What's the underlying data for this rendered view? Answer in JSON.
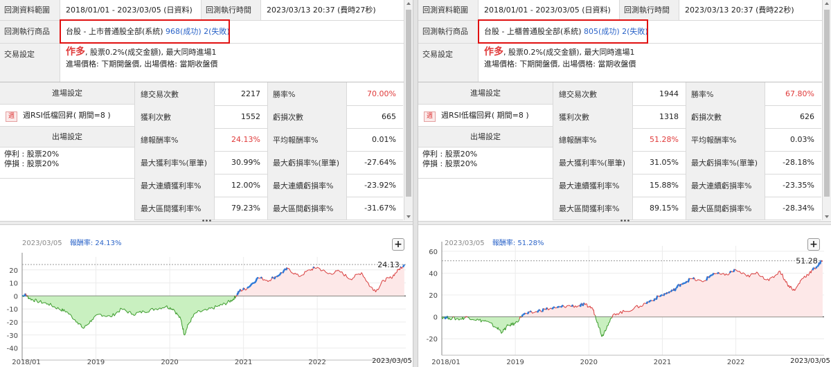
{
  "panels": [
    {
      "backtest_range_label": "回測資料範圍",
      "backtest_range_value": "2018/01/01 - 2023/03/05 (日資料)",
      "exec_time_label": "回測執行時間",
      "exec_time_value": "2023/03/13 20:37 (費時27秒)",
      "product_label": "回測執行商品",
      "product_name": "台股 - 上市普通股全部(系統)",
      "product_success": "968(成功)",
      "product_fail": "2(失敗)",
      "trade_label": "交易設定",
      "trade_direction": "作多",
      "trade_line1": ", 股票0.2%(成交金額), 最大同時進場1",
      "trade_line2": "進場價格: 下期開盤價, 出場價格: 當期收盤價",
      "entry_header": "進場設定",
      "entry_tag": "週",
      "entry_value": "週RSI低檔回昇( 期間=8 )",
      "exit_header": "出場設定",
      "exit_line1": "停利 : 股票20%",
      "exit_line2": "停損 : 股票20%",
      "stats": [
        {
          "l1": "總交易次數",
          "v1": "2217",
          "l2": "勝率%",
          "v2": "70.00%",
          "v2red": true
        },
        {
          "l1": "獲利次數",
          "v1": "1552",
          "l2": "虧損次數",
          "v2": "665"
        },
        {
          "l1": "總報酬率%",
          "v1": "24.13%",
          "v1red": true,
          "l2": "平均報酬率%",
          "v2": "0.01%"
        },
        {
          "l1": "最大獲利率%(單筆)",
          "v1": "30.99%",
          "l2": "最大虧損率%(單筆)",
          "v2": "-27.64%"
        },
        {
          "l1": "最大連續獲利率%",
          "v1": "12.00%",
          "l2": "最大連續虧損率%",
          "v2": "-23.92%"
        },
        {
          "l1": "最大區間獲利率%",
          "v1": "79.23%",
          "l2": "最大區間虧損率%",
          "v2": "-31.67%"
        }
      ],
      "chart_header_date": "2023/03/05",
      "chart_header_label": "報酬率: 24.13%",
      "chart_last_label": "24.13",
      "chart_bottom_date": "2023/03/05",
      "add_glyph": "+",
      "divider_glyph": "•••",
      "chart_data": {
        "type": "area",
        "series_name": "報酬率",
        "yticks": [
          -40,
          -30,
          -20,
          -10,
          0,
          10,
          20
        ],
        "ytick_labels": [
          "-40",
          "-30",
          "-20",
          "-10",
          "0",
          "10",
          "20"
        ],
        "ylim": [
          -45,
          30
        ],
        "xlim": [
          2018.0,
          2023.2
        ],
        "xticks": [
          2018.0,
          2019.0,
          2020.0,
          2021.0,
          2022.0
        ],
        "xtick_labels": [
          "2018/01",
          "2019",
          "2020",
          "2021",
          "2022"
        ],
        "keypoints": [
          [
            2018.0,
            0
          ],
          [
            2018.05,
            1
          ],
          [
            2018.1,
            -2
          ],
          [
            2018.2,
            -4
          ],
          [
            2018.35,
            -6
          ],
          [
            2018.5,
            -10
          ],
          [
            2018.6,
            -12
          ],
          [
            2018.75,
            -20
          ],
          [
            2018.83,
            -25
          ],
          [
            2018.95,
            -18
          ],
          [
            2019.05,
            -14
          ],
          [
            2019.2,
            -16
          ],
          [
            2019.35,
            -10
          ],
          [
            2019.5,
            -14
          ],
          [
            2019.65,
            -12
          ],
          [
            2019.8,
            -10
          ],
          [
            2019.95,
            -8
          ],
          [
            2020.05,
            -10
          ],
          [
            2020.15,
            -18
          ],
          [
            2020.2,
            -30
          ],
          [
            2020.25,
            -22
          ],
          [
            2020.35,
            -13
          ],
          [
            2020.5,
            -11
          ],
          [
            2020.65,
            -8
          ],
          [
            2020.75,
            -6
          ],
          [
            2020.85,
            -3
          ],
          [
            2020.9,
            0
          ],
          [
            2020.95,
            4
          ],
          [
            2021.05,
            6
          ],
          [
            2021.2,
            14
          ],
          [
            2021.35,
            12
          ],
          [
            2021.5,
            17
          ],
          [
            2021.6,
            21
          ],
          [
            2021.75,
            15
          ],
          [
            2021.9,
            20
          ],
          [
            2022.0,
            22
          ],
          [
            2022.15,
            17
          ],
          [
            2022.3,
            19
          ],
          [
            2022.45,
            13
          ],
          [
            2022.6,
            18
          ],
          [
            2022.72,
            7
          ],
          [
            2022.8,
            4
          ],
          [
            2022.9,
            12
          ],
          [
            2023.0,
            14
          ],
          [
            2023.1,
            20
          ],
          [
            2023.18,
            24.13
          ]
        ],
        "dashed_ref": 24.13
      }
    },
    {
      "backtest_range_label": "回測資料範圍",
      "backtest_range_value": "2018/01/01 - 2023/03/05 (日資料)",
      "exec_time_label": "回測執行時間",
      "exec_time_value": "2023/03/13 20:37 (費時22秒)",
      "product_label": "回測執行商品",
      "product_name": "台股 - 上櫃普通股全部(系統)",
      "product_success": "805(成功)",
      "product_fail": "2(失敗)",
      "trade_label": "交易設定",
      "trade_direction": "作多",
      "trade_line1": ", 股票0.2%(成交金額), 最大同時進場1",
      "trade_line2": "進場價格: 下期開盤價, 出場價格: 當期收盤價",
      "entry_header": "進場設定",
      "entry_tag": "週",
      "entry_value": "週RSI低檔回昇( 期間=8 )",
      "exit_header": "出場設定",
      "exit_line1": "停利 : 股票20%",
      "exit_line2": "停損 : 股票20%",
      "stats": [
        {
          "l1": "總交易次數",
          "v1": "1944",
          "l2": "勝率%",
          "v2": "67.80%",
          "v2red": true
        },
        {
          "l1": "獲利次數",
          "v1": "1318",
          "l2": "虧損次數",
          "v2": "626"
        },
        {
          "l1": "總報酬率%",
          "v1": "51.28%",
          "v1red": true,
          "l2": "平均報酬率%",
          "v2": "0.03%"
        },
        {
          "l1": "最大獲利率%(單筆)",
          "v1": "31.05%",
          "l2": "最大虧損率%(單筆)",
          "v2": "-28.18%"
        },
        {
          "l1": "最大連續獲利率%",
          "v1": "15.88%",
          "l2": "最大連續虧損率%",
          "v2": "-23.35%"
        },
        {
          "l1": "最大區間獲利率%",
          "v1": "89.15%",
          "l2": "最大區間虧損率%",
          "v2": "-28.34%"
        }
      ],
      "chart_header_date": "2023/03/05",
      "chart_header_label": "報酬率: 51.28%",
      "chart_last_label": "51.28",
      "chart_bottom_date": "2023/03/05",
      "add_glyph": "+",
      "divider_glyph": "•••",
      "chart_data": {
        "type": "area",
        "series_name": "報酬率",
        "yticks": [
          -20,
          0,
          20,
          40,
          60
        ],
        "ytick_labels": [
          "-20",
          "0",
          "20",
          "40",
          "60"
        ],
        "ylim": [
          -30,
          65
        ],
        "xlim": [
          2018.0,
          2023.2
        ],
        "xticks": [
          2018.0,
          2019.0,
          2020.0,
          2021.0,
          2022.0
        ],
        "xtick_labels": [
          "2018/01",
          "2019",
          "2020",
          "2021",
          "2022"
        ],
        "keypoints": [
          [
            2018.0,
            0
          ],
          [
            2018.1,
            -1
          ],
          [
            2018.25,
            -2
          ],
          [
            2018.35,
            0
          ],
          [
            2018.5,
            -3
          ],
          [
            2018.6,
            -4
          ],
          [
            2018.75,
            -10
          ],
          [
            2018.82,
            -14
          ],
          [
            2018.9,
            -8
          ],
          [
            2019.0,
            -6
          ],
          [
            2019.1,
            2
          ],
          [
            2019.25,
            4
          ],
          [
            2019.4,
            7
          ],
          [
            2019.55,
            8
          ],
          [
            2019.7,
            10
          ],
          [
            2019.85,
            10
          ],
          [
            2019.95,
            11
          ],
          [
            2020.05,
            8
          ],
          [
            2020.12,
            -5
          ],
          [
            2020.18,
            -18
          ],
          [
            2020.25,
            -8
          ],
          [
            2020.35,
            3
          ],
          [
            2020.5,
            5
          ],
          [
            2020.7,
            10
          ],
          [
            2020.85,
            15
          ],
          [
            2021.0,
            20
          ],
          [
            2021.15,
            24
          ],
          [
            2021.25,
            30
          ],
          [
            2021.4,
            35
          ],
          [
            2021.55,
            32
          ],
          [
            2021.7,
            40
          ],
          [
            2021.85,
            38
          ],
          [
            2022.0,
            43
          ],
          [
            2022.15,
            37
          ],
          [
            2022.3,
            40
          ],
          [
            2022.45,
            33
          ],
          [
            2022.6,
            42
          ],
          [
            2022.7,
            30
          ],
          [
            2022.8,
            24
          ],
          [
            2022.9,
            35
          ],
          [
            2023.0,
            40
          ],
          [
            2023.1,
            46
          ],
          [
            2023.18,
            51.28
          ]
        ],
        "dashed_ref": 51.28
      }
    }
  ]
}
